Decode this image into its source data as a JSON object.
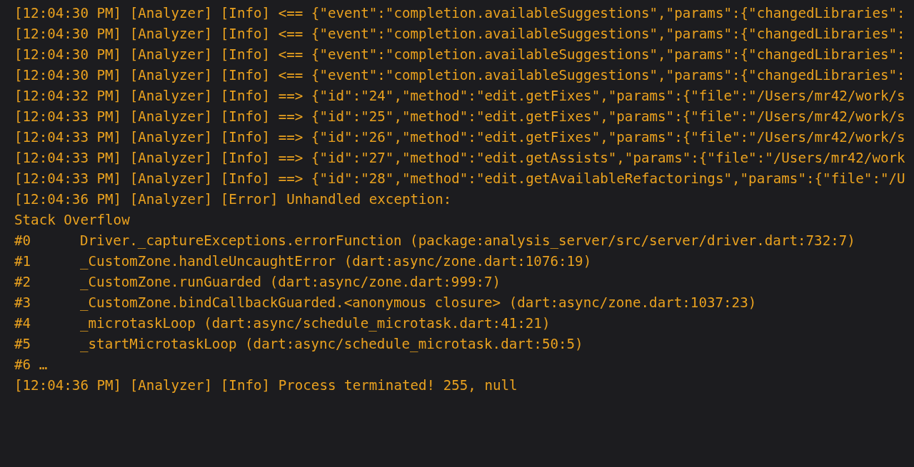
{
  "log_lines": [
    {
      "kind": "log",
      "text": "[12:04:30 PM] [Analyzer] [Info] <== {\"event\":\"completion.availableSuggestions\",\"params\":{\"changedLibraries\":"
    },
    {
      "kind": "log",
      "text": "[12:04:30 PM] [Analyzer] [Info] <== {\"event\":\"completion.availableSuggestions\",\"params\":{\"changedLibraries\":"
    },
    {
      "kind": "log",
      "text": "[12:04:30 PM] [Analyzer] [Info] <== {\"event\":\"completion.availableSuggestions\",\"params\":{\"changedLibraries\":"
    },
    {
      "kind": "log",
      "text": "[12:04:30 PM] [Analyzer] [Info] <== {\"event\":\"completion.availableSuggestions\",\"params\":{\"changedLibraries\":"
    },
    {
      "kind": "log",
      "text": "[12:04:32 PM] [Analyzer] [Info] ==> {\"id\":\"24\",\"method\":\"edit.getFixes\",\"params\":{\"file\":\"/Users/mr42/work/s"
    },
    {
      "kind": "log",
      "text": "[12:04:33 PM] [Analyzer] [Info] ==> {\"id\":\"25\",\"method\":\"edit.getFixes\",\"params\":{\"file\":\"/Users/mr42/work/s"
    },
    {
      "kind": "log",
      "text": "[12:04:33 PM] [Analyzer] [Info] ==> {\"id\":\"26\",\"method\":\"edit.getFixes\",\"params\":{\"file\":\"/Users/mr42/work/s"
    },
    {
      "kind": "log",
      "text": "[12:04:33 PM] [Analyzer] [Info] ==> {\"id\":\"27\",\"method\":\"edit.getAssists\",\"params\":{\"file\":\"/Users/mr42/work"
    },
    {
      "kind": "log",
      "text": "[12:04:33 PM] [Analyzer] [Info] ==> {\"id\":\"28\",\"method\":\"edit.getAvailableRefactorings\",\"params\":{\"file\":\"/U"
    },
    {
      "kind": "log",
      "text": "[12:04:36 PM] [Analyzer] [Error] Unhandled exception:"
    },
    {
      "kind": "log",
      "text": "Stack Overflow"
    },
    {
      "kind": "frame",
      "index": "#0",
      "text": "Driver._captureExceptions.errorFunction (package:analysis_server/src/server/driver.dart:732:7)"
    },
    {
      "kind": "frame",
      "index": "#1",
      "text": "_CustomZone.handleUncaughtError (dart:async/zone.dart:1076:19)"
    },
    {
      "kind": "frame",
      "index": "#2",
      "text": "_CustomZone.runGuarded (dart:async/zone.dart:999:7)"
    },
    {
      "kind": "frame",
      "index": "#3",
      "text": "_CustomZone.bindCallbackGuarded.<anonymous closure> (dart:async/zone.dart:1037:23)"
    },
    {
      "kind": "frame",
      "index": "#4",
      "text": "_microtaskLoop (dart:async/schedule_microtask.dart:41:21)"
    },
    {
      "kind": "frame",
      "index": "#5",
      "text": "_startMicrotaskLoop (dart:async/schedule_microtask.dart:50:5)"
    },
    {
      "kind": "log",
      "text": "#6 …"
    },
    {
      "kind": "log",
      "text": "[12:04:36 PM] [Analyzer] [Info] Process terminated! 255, null"
    }
  ]
}
